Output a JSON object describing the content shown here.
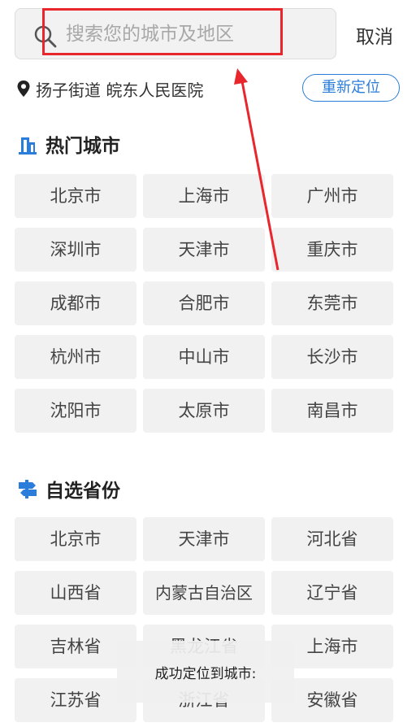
{
  "search": {
    "placeholder": "搜索您的城市及地区",
    "cancel_label": "取消"
  },
  "location": {
    "text": "扬子街道 皖东人民医院",
    "relocate_label": "重新定位"
  },
  "hot_cities": {
    "title": "热门城市",
    "items": [
      "北京市",
      "上海市",
      "广州市",
      "深圳市",
      "天津市",
      "重庆市",
      "成都市",
      "合肥市",
      "东莞市",
      "杭州市",
      "中山市",
      "长沙市",
      "沈阳市",
      "太原市",
      "南昌市"
    ]
  },
  "provinces": {
    "title": "自选省份",
    "items": [
      "北京市",
      "天津市",
      "河北省",
      "山西省",
      "内蒙古自治区",
      "辽宁省",
      "吉林省",
      "黑龙江省",
      "上海市",
      "江苏省",
      "浙江省",
      "安徽省"
    ]
  },
  "toast": {
    "text": "成功定位到城市:"
  },
  "colors": {
    "accent": "#2a7ddb",
    "annotation": "#e8262b"
  },
  "icons": [
    "search-icon",
    "location-pin-icon",
    "building-icon",
    "signpost-icon"
  ]
}
